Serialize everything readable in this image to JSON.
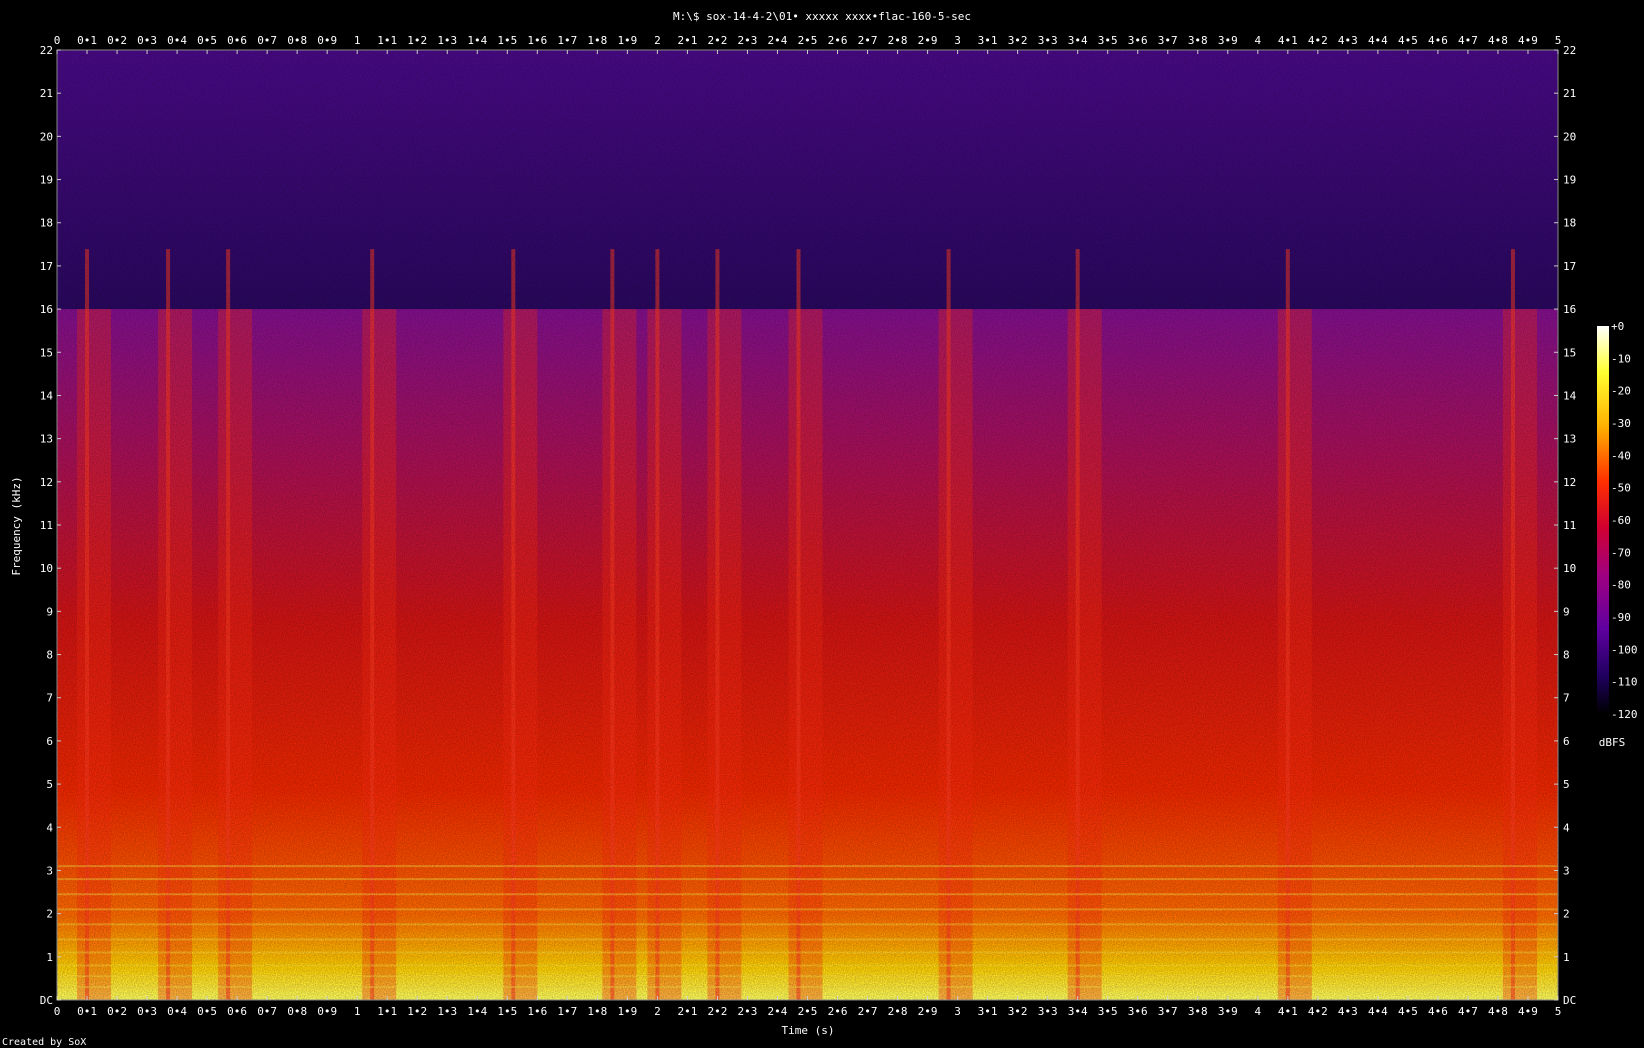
{
  "chart_data": {
    "type": "heatmap",
    "title": "M:\\$ sox-14-4-2\\01• xxxxx xxxx•flac-160-5-sec",
    "xlabel": "Time (s)",
    "ylabel": "Frequency (kHz)",
    "xlim": [
      0,
      5
    ],
    "ylim": [
      0,
      22
    ],
    "x_ticks": [
      "0",
      "0•1",
      "0•2",
      "0•3",
      "0•4",
      "0•5",
      "0•6",
      "0•7",
      "0•8",
      "0•9",
      "1",
      "1•1",
      "1•2",
      "1•3",
      "1•4",
      "1•5",
      "1•6",
      "1•7",
      "1•8",
      "1•9",
      "2",
      "2•1",
      "2•2",
      "2•3",
      "2•4",
      "2•5",
      "2•6",
      "2•7",
      "2•8",
      "2•9",
      "3",
      "3•1",
      "3•2",
      "3•3",
      "3•4",
      "3•5",
      "3•6",
      "3•7",
      "3•8",
      "3•9",
      "4",
      "4•1",
      "4•2",
      "4•3",
      "4•4",
      "4•5",
      "4•6",
      "4•7",
      "4•8",
      "4•9",
      "5"
    ],
    "y_ticks": [
      "DC",
      "1",
      "2",
      "3",
      "4",
      "5",
      "6",
      "7",
      "8",
      "9",
      "10",
      "11",
      "12",
      "13",
      "14",
      "15",
      "16",
      "17",
      "18",
      "19",
      "20",
      "21",
      "22"
    ],
    "colorbar": {
      "label": "dBFS",
      "ticks": [
        "+0",
        "-10",
        "-20",
        "-30",
        "-40",
        "-50",
        "-60",
        "-70",
        "-80",
        "-90",
        "-100",
        "-110",
        "-120"
      ],
      "range": [
        -120,
        0
      ]
    },
    "note": "Created by SoX",
    "lowpass_cutoff_khz": 16,
    "onsets_s": [
      0.1,
      0.37,
      0.57,
      1.05,
      1.52,
      1.85,
      2.0,
      2.2,
      2.47,
      2.97,
      3.4,
      4.1,
      4.85
    ]
  }
}
